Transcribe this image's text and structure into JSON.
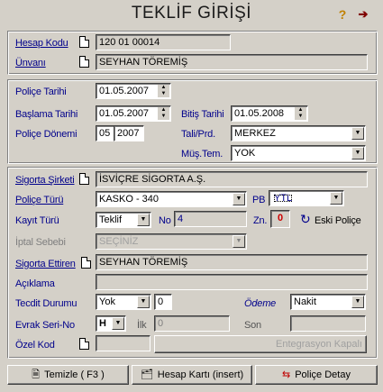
{
  "window": {
    "title": "TEKLİF GİRİŞİ",
    "help_icon": "help-icon",
    "exit_icon": "exit-icon"
  },
  "account": {
    "hesap_kodu_label": "Hesap Kodu",
    "hesap_kodu_value": "120 01 00014",
    "unvani_label": "Ünvanı",
    "unvani_value": "SEYHAN TÖREMİŞ"
  },
  "policy_dates": {
    "police_tarihi_label": "Poliçe Tarihi",
    "police_tarihi_value": "01.05.2007",
    "baslama_tarihi_label": "Başlama Tarihi",
    "baslama_tarihi_value": "01.05.2007",
    "bitis_tarihi_label": "Bitiş Tarihi",
    "bitis_tarihi_value": "01.05.2008",
    "police_donemi_label": "Poliçe Dönemi",
    "police_donemi_month": "05",
    "police_donemi_year": "2007",
    "tali_prd_label": "Tali/Prd.",
    "tali_prd_value": "MERKEZ",
    "mus_tem_label": "Müş.Tem.",
    "mus_tem_value": "YOK"
  },
  "details": {
    "sigorta_sirketi_label": "Sigorta Şirketi",
    "sigorta_sirketi_value": "İSVİÇRE SİGORTA A.Ş.",
    "police_turu_label": "Poliçe Türü",
    "police_turu_value": "KASKO - 340",
    "pb_label": "PB",
    "pb_value": "YTL",
    "kayit_turu_label": "Kayıt Türü",
    "kayit_turu_value": "Teklif",
    "no_label": "No",
    "no_value": "4",
    "zn_label": "Zn.",
    "zn_value": "0",
    "eski_police_label": "Eski Poliçe",
    "iptal_sebebi_label": "İptal Sebebi",
    "iptal_sebebi_value": "SEÇİNİZ",
    "sigorta_ettiren_label": "Sigorta Ettiren",
    "sigorta_ettiren_value": "SEYHAN TÖREMİŞ",
    "aciklama_label": "Açıklama",
    "aciklama_value": "",
    "tecdit_durumu_label": "Tecdit Durumu",
    "tecdit_durumu_value": "Yok",
    "tecdit_count_value": "0",
    "odeme_label": "Ödeme",
    "odeme_value": "Nakit",
    "evrak_seri_no_label": "Evrak Seri-No",
    "evrak_seri_value": "H",
    "ilk_label": "İlk",
    "ilk_value": "0",
    "son_label": "Son",
    "son_value": "",
    "ozel_kod_label": "Özel Kod",
    "ozel_kod_value": "",
    "entegrasyon_label": "Entegrasyon Kapalı"
  },
  "footer": {
    "temizle_label": "Temizle ( F3 )",
    "hesap_karti_label": "Hesap Kartı (insert)",
    "police_detay_label": "Poliçe Detay"
  }
}
